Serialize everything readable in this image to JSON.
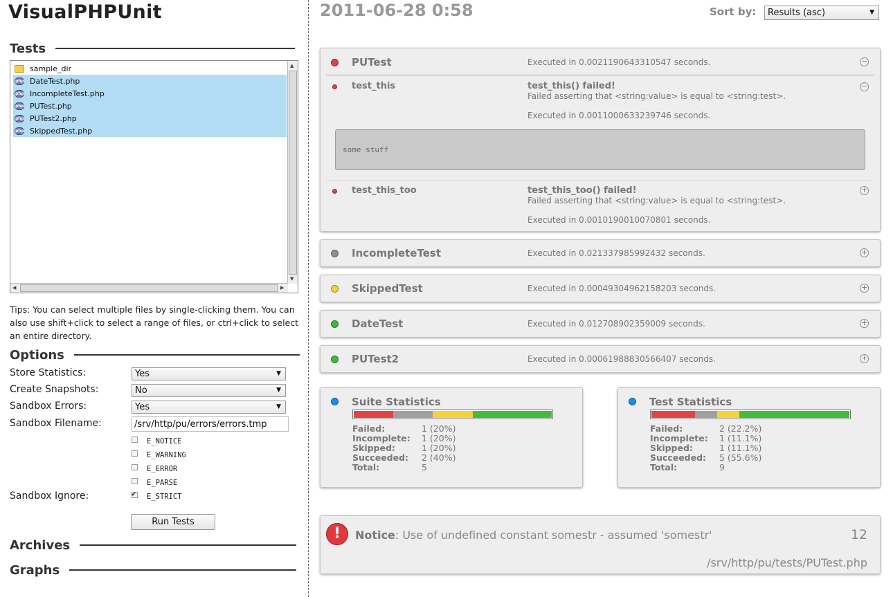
{
  "app": {
    "title": "VisualPHPUnit"
  },
  "sections": {
    "tests": "Tests",
    "options": "Options",
    "archives": "Archives",
    "graphs": "Graphs"
  },
  "files": [
    {
      "name": "sample_dir",
      "icon": "folder-icon",
      "selected": false
    },
    {
      "name": "DateTest.php",
      "icon": "php-file-icon",
      "selected": true
    },
    {
      "name": "IncompleteTest.php",
      "icon": "php-file-icon",
      "selected": true
    },
    {
      "name": "PUTest.php",
      "icon": "php-file-icon",
      "selected": true
    },
    {
      "name": "PUTest2.php",
      "icon": "php-file-icon",
      "selected": true
    },
    {
      "name": "SkippedTest.php",
      "icon": "php-file-icon",
      "selected": true
    }
  ],
  "php_icon_text": "php",
  "tips": "Tips: You can select multiple files by single-clicking them. You can also use shift+click to select a range of files, or ctrl+click to select an entire directory.",
  "options": {
    "store_statistics": {
      "label": "Store Statistics:",
      "value": "Yes"
    },
    "create_snapshots": {
      "label": "Create Snapshots:",
      "value": "No"
    },
    "sandbox_errors": {
      "label": "Sandbox Errors:",
      "value": "Yes"
    },
    "sandbox_filename": {
      "label": "Sandbox Filename:",
      "value": "/srv/http/pu/errors/errors.tmp"
    },
    "sandbox_ignore": {
      "label": "Sandbox Ignore:",
      "items": [
        {
          "label": "E_NOTICE",
          "checked": false
        },
        {
          "label": "E_WARNING",
          "checked": false
        },
        {
          "label": "E_ERROR",
          "checked": false
        },
        {
          "label": "E_PARSE",
          "checked": false
        },
        {
          "label": "E_STRICT",
          "checked": true
        }
      ]
    },
    "run_button": "Run Tests"
  },
  "header": {
    "date": "2011-06-28 0:58",
    "sort_label": "Sort by:",
    "sort_value": "Results (asc)"
  },
  "suites": {
    "putest": {
      "name": "PUTest",
      "status": "failed",
      "exec": "Executed in 0.0021190643310547 seconds.",
      "toggle": "−",
      "tests": [
        {
          "name": "test_this",
          "title": "test_this() failed!",
          "message": "Failed asserting that <string:value> is equal to <string:test>.",
          "exec": "Executed in 0.0011000633239746 seconds.",
          "output": "some stuff",
          "toggle": "−"
        },
        {
          "name": "test_this_too",
          "title": "test_this_too() failed!",
          "message": "Failed asserting that <string:value> is equal to <string:test>.",
          "exec": "Executed in 0.0010190010070801 seconds.",
          "toggle": "+"
        }
      ]
    },
    "collapsed": [
      {
        "name": "IncompleteTest",
        "status": "incomplete",
        "color": "grey",
        "exec": "Executed in 0.021337985992432 seconds.",
        "toggle": "+"
      },
      {
        "name": "SkippedTest",
        "status": "skipped",
        "color": "yellow",
        "exec": "Executed in 0.00049304962158203 seconds.",
        "toggle": "+"
      },
      {
        "name": "DateTest",
        "status": "succeeded",
        "color": "green",
        "exec": "Executed in 0.012708902359009 seconds.",
        "toggle": "+"
      },
      {
        "name": "PUTest2",
        "status": "succeeded",
        "color": "green",
        "exec": "Executed in 0.00061988830566407 seconds.",
        "toggle": "+"
      }
    ]
  },
  "statistics": {
    "suite": {
      "title": "Suite Statistics",
      "rows": [
        {
          "label": "Failed:",
          "value": "1 (20%)"
        },
        {
          "label": "Incomplete:",
          "value": "1 (20%)"
        },
        {
          "label": "Skipped:",
          "value": "1 (20%)"
        },
        {
          "label": "Succeeded:",
          "value": "2 (40%)"
        },
        {
          "label": "Total:",
          "value": "5"
        }
      ],
      "bar": {
        "failed": 20,
        "incomplete": 20,
        "skipped": 20,
        "succeeded": 40
      }
    },
    "test": {
      "title": "Test Statistics",
      "rows": [
        {
          "label": "Failed:",
          "value": "2 (22.2%)"
        },
        {
          "label": "Incomplete:",
          "value": "1 (11.1%)"
        },
        {
          "label": "Skipped:",
          "value": "1 (11.1%)"
        },
        {
          "label": "Succeeded:",
          "value": "5 (55.6%)"
        },
        {
          "label": "Total:",
          "value": "9"
        }
      ],
      "bar": {
        "failed": 22.2,
        "incomplete": 11.1,
        "skipped": 11.1,
        "succeeded": 55.6
      }
    }
  },
  "notice": {
    "icon": "!",
    "type": "Notice",
    "message": ": Use of undefined constant somestr - assumed 'somestr'",
    "line": "12",
    "file": "/srv/http/pu/tests/PUTest.php"
  },
  "colors": {
    "failed": "#e04242",
    "incomplete": "#909090",
    "skipped": "#f5d040",
    "succeeded": "#3cbc3c",
    "selection": "#b3dcf5"
  }
}
